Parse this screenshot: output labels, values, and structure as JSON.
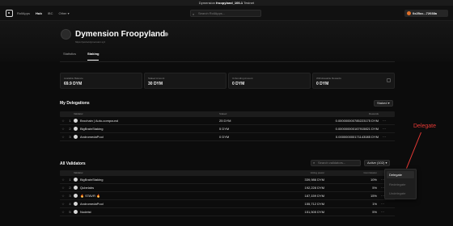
{
  "banner": {
    "prefix": "Dymension",
    "network": "froopyland_100-1",
    "suffix": "Testnet"
  },
  "nav": {
    "links": [
      "RollApps",
      "Hub",
      "IBC",
      "Other ▾"
    ],
    "search_placeholder": "Search RollApps...",
    "search_shortcut": "⌘K",
    "wallet_address": "0x25cc...72038a"
  },
  "header": {
    "title": "Dymension Froopyland",
    "subtitle": "https://portal.dymension.xyz",
    "tabs": [
      "Statistics",
      "Staking"
    ]
  },
  "stats": [
    {
      "label": "Available Balance",
      "value": "69.9 DYM"
    },
    {
      "label": "Staked Amount",
      "value": "30 DYM"
    },
    {
      "label": "Unbonding Amount",
      "value": "0 DYM"
    },
    {
      "label": "Withdrawable Rewards",
      "value": "0 DYM"
    }
  ],
  "delegations": {
    "title": "My Delegations",
    "filter": "Staked ▾",
    "columns": [
      "Validator",
      "Staked",
      "Rewards"
    ],
    "rows": [
      {
        "num": "1",
        "name": "Brochain | Auto-compound",
        "staked": "25 DYM",
        "rewards": "0.000000000785223175 DYM"
      },
      {
        "num": "2",
        "name": "BigBrainStaking",
        "staked": "5 DYM",
        "rewards": "0.000000000167915821 DYM"
      },
      {
        "num": "3",
        "name": "AndromedaPool",
        "staked": "0 DYM",
        "rewards": "0.000000000171143085 DYM"
      }
    ]
  },
  "validators": {
    "title": "All Validators",
    "search_placeholder": "Search validators...",
    "filter": "Active (102) ▾",
    "columns": [
      "Validator",
      "Voting power",
      "Commission"
    ],
    "rows": [
      {
        "num": "1",
        "name": "BigBrainStaking",
        "power": "339,986 DYM",
        "commission": "10%"
      },
      {
        "num": "2",
        "name": "Qubelabs",
        "power": "192,228 DYM",
        "commission": "5%"
      },
      {
        "num": "3",
        "name": "🔥 STAVR 🔥",
        "power": "187,159 DYM",
        "commission": "15%"
      },
      {
        "num": "4",
        "name": "AndromedaPool",
        "power": "155,712 DYM",
        "commission": "1%"
      },
      {
        "num": "5",
        "name": "Nodeist",
        "power": "151,505 DYM",
        "commission": "5%"
      }
    ]
  },
  "popup_menu": {
    "items": [
      "Delegate",
      "Redelegate",
      "Undelegate"
    ]
  },
  "annotation": {
    "label": "Delegate",
    "color": "#e53935"
  }
}
